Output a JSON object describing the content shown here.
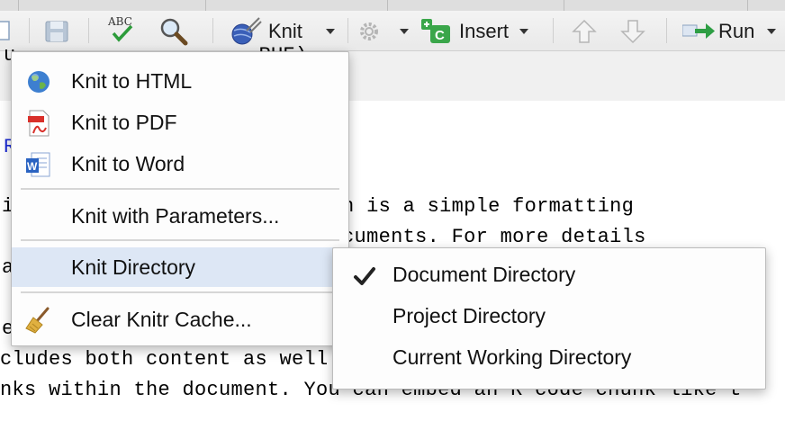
{
  "toolbar": {
    "knit_label": "Knit",
    "insert_label": "Insert",
    "run_label": "Run",
    "icons": [
      "new-doc-icon",
      "save-icon",
      "spellcheck-icon",
      "find-icon",
      "knit-yarn-icon",
      "gear-icon",
      "insert-chunk-icon",
      "up-arrow-icon",
      "down-arrow-icon",
      "run-icon"
    ],
    "spellcheck_text": "ABC"
  },
  "editor": {
    "line_1": "u                    RUE)¬",
    "line_2": "R",
    "line_3": "is                 . Markdown is a simple formatting",
    "line_4": "                   S Word documents. For more details",
    "line_5": "ar",
    "line_6": "e                                                   d",
    "line_7": "cludes both content as well                         co",
    "line_8": "nks within the document. You can embed an R code chunk like t"
  },
  "knit_menu": {
    "items": [
      {
        "label": "Knit to HTML",
        "icon": "globe-icon"
      },
      {
        "label": "Knit to PDF",
        "icon": "pdf-icon"
      },
      {
        "label": "Knit to Word",
        "icon": "word-icon"
      },
      {
        "label": "Knit with Parameters...",
        "icon": ""
      },
      {
        "label": "Knit Directory",
        "icon": "",
        "active": true
      },
      {
        "label": "Clear Knitr Cache...",
        "icon": "broom-icon"
      }
    ]
  },
  "directory_submenu": {
    "items": [
      {
        "label": "Document Directory",
        "checked": true
      },
      {
        "label": "Project Directory",
        "checked": false
      },
      {
        "label": "Current Working Directory",
        "checked": false
      }
    ]
  },
  "colors": {
    "highlight": "#dde7f5",
    "code_blue": "#1c2bd4",
    "insert_green": "#3aa64a",
    "run_green": "#2e9e44"
  }
}
